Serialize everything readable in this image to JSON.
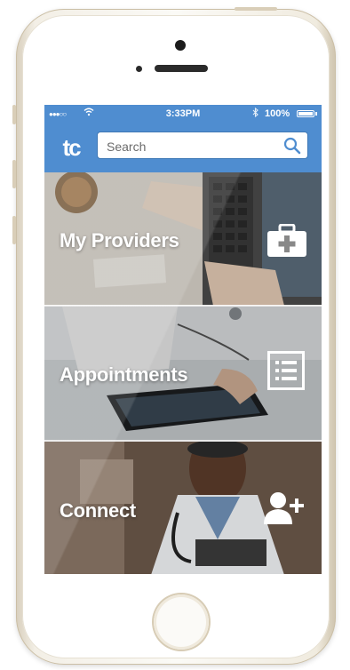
{
  "status_bar": {
    "signal": "●●●○○",
    "time": "3:33PM",
    "battery": "100%"
  },
  "header": {
    "logo": "tc",
    "search_placeholder": "Search"
  },
  "tiles": [
    {
      "label": "My Providers",
      "icon": "medical-kit-icon"
    },
    {
      "label": "Appointments",
      "icon": "list-icon"
    },
    {
      "label": "Connect",
      "icon": "add-user-icon"
    }
  ],
  "colors": {
    "brand_blue": "#4f8dd0"
  }
}
